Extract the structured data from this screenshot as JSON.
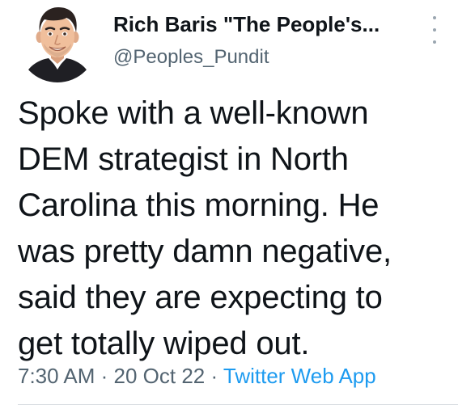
{
  "tweet": {
    "display_name": "Rich Baris \"The People's...",
    "handle": "@Peoples_Pundit",
    "text": "Spoke with a well-known\nDEM strategist in North\nCarolina this morning. He\nwas pretty damn negative,\nsaid they are expecting to\nget totally wiped out.",
    "time": "7:30 AM",
    "separator": " · ",
    "date": "20 Oct 22",
    "source": "Twitter Web App",
    "more_icon": "vertical-ellipsis-icon",
    "avatar": "cartoon-avatar"
  },
  "colors": {
    "text": "#0f1419",
    "secondary": "#536471",
    "link": "#1d9bf0"
  }
}
